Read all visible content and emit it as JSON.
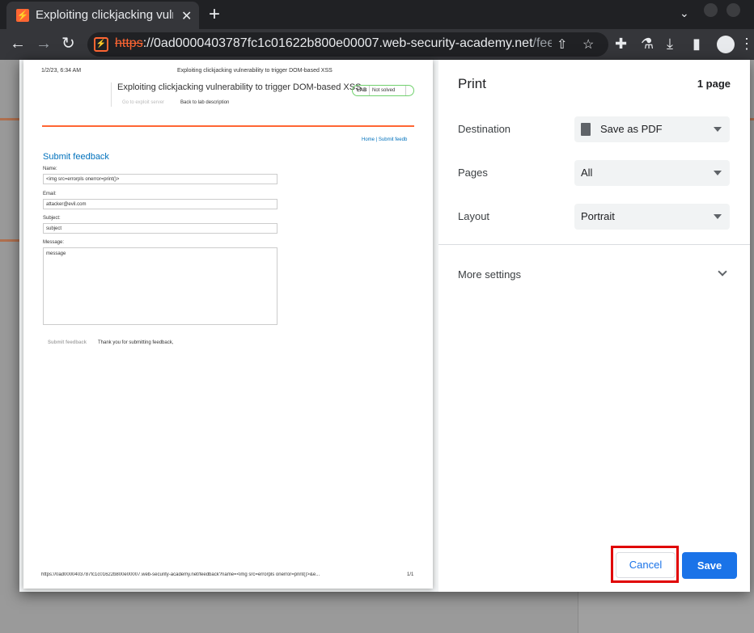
{
  "browser": {
    "tab_title": "Exploiting clickjacking vulne",
    "tab_close": "✕",
    "new_tab": "+",
    "url_scheme": "https",
    "url_host": "://0ad0000403787fc1c01622b800e00007.web-security-academy.net",
    "url_path": "/feedbac..."
  },
  "dialog": {
    "title": "Print",
    "page_count": "1 page",
    "destination_label": "Destination",
    "destination_value": "Save as PDF",
    "pages_label": "Pages",
    "pages_value": "All",
    "layout_label": "Layout",
    "layout_value": "Portrait",
    "more_settings": "More settings",
    "cancel": "Cancel",
    "save": "Save"
  },
  "preview": {
    "header_date": "1/2/23, 6:34 AM",
    "header_title": "Exploiting clickjacking vulnerability to trigger DOM-based XSS",
    "lab_title": "Exploiting clickjacking vulnerability to trigger DOM-based XSS",
    "lab_badge": "LAB",
    "lab_status": "Not solved",
    "exploit_link": "Go to exploit server",
    "back_link": "Back to lab description",
    "nav_home": "Home",
    "nav_sep": "|",
    "nav_submit": "Submit feedb",
    "form_heading": "Submit feedback",
    "name_label": "Name:",
    "name_value": "<img src=errorpls onerror=print()>",
    "email_label": "Email:",
    "email_value": "attacker@evil.com",
    "subject_label": "Subject:",
    "subject_value": "subject",
    "message_label": "Message:",
    "message_value": "message",
    "submit_label": "Submit feedback",
    "thanks_text": "Thank you for submitting feedback,",
    "footer_url": "https://0ad0000403787fc1c01622b800e00007.web-security-academy.net/feedback?name=<img src=errorpls onerror=print()>&e...",
    "footer_page": "1/1"
  }
}
